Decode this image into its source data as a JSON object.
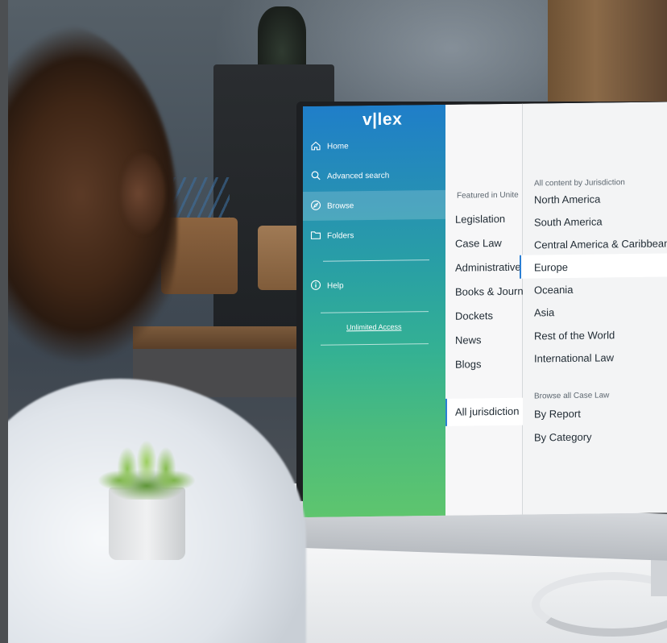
{
  "app": {
    "logo": "v|lex"
  },
  "sidebar": {
    "items": [
      {
        "label": "Home",
        "icon": "home-icon"
      },
      {
        "label": "Advanced search",
        "icon": "search-icon"
      },
      {
        "label": "Browse",
        "icon": "compass-icon",
        "active": true
      },
      {
        "label": "Folders",
        "icon": "folder-icon"
      },
      {
        "label": "Help",
        "icon": "info-icon"
      }
    ],
    "unlimited_access": "Unlimited Access"
  },
  "featured": {
    "heading": "Featured in Unite",
    "items": [
      "Legislation",
      "Case Law",
      "Administrative",
      "Books & Journ",
      "Dockets",
      "News",
      "Blogs"
    ],
    "all_jurisdictions": "All jurisdiction"
  },
  "jurisdiction": {
    "heading": "All content by Jurisdiction",
    "items": [
      "North America",
      "South America",
      "Central America & Caribbean",
      "Europe",
      "Oceania",
      "Asia",
      "Rest of the World",
      "International Law"
    ],
    "selected": "Europe",
    "case_law_heading": "Browse all Case Law",
    "case_law_items": [
      "By Report",
      "By Category"
    ]
  },
  "colors": {
    "sidebar_top": "#1f7ec9",
    "sidebar_bottom": "#5ec56e",
    "selection_accent": "#2b7fd4"
  }
}
